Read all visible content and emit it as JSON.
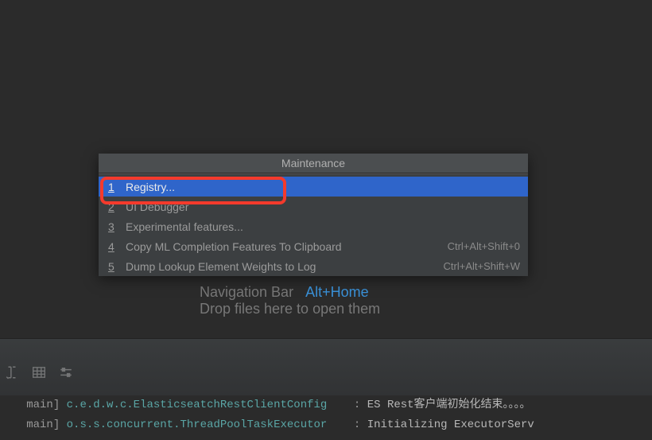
{
  "popup": {
    "title": "Maintenance",
    "items": [
      {
        "num": "1",
        "label": "Registry...",
        "shortcut": "",
        "selected": true
      },
      {
        "num": "2",
        "label": "UI Debugger",
        "shortcut": "",
        "selected": false
      },
      {
        "num": "3",
        "label": "Experimental features...",
        "shortcut": "",
        "selected": false
      },
      {
        "num": "4",
        "label": "Copy ML Completion Features To Clipboard",
        "shortcut": "Ctrl+Alt+Shift+0",
        "selected": false
      },
      {
        "num": "5",
        "label": "Dump Lookup Element Weights to Log",
        "shortcut": "Ctrl+Alt+Shift+W",
        "selected": false
      }
    ]
  },
  "background": {
    "nav_label": "Navigation Bar",
    "nav_hotkey": "Alt+Home",
    "drop_label": "Drop files here to open them"
  },
  "console": {
    "lines": [
      {
        "prefix": "main]",
        "logger": "c.e.d.w.c.ElasticseatchRestClientConfig",
        "sep": ":",
        "msg": "ES Rest客户端初始化结束。。。。"
      },
      {
        "prefix": "main]",
        "logger": "o.s.s.concurrent.ThreadPoolTaskExecutor",
        "sep": ":",
        "msg": "Initializing ExecutorServ"
      }
    ]
  }
}
